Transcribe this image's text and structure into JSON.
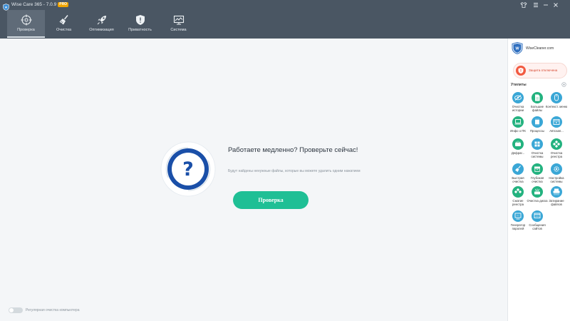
{
  "app": {
    "title": "Wise Care 365 - 7.0.9",
    "badge": "PRO"
  },
  "nav": {
    "tabs": [
      {
        "id": "check",
        "label": "Проверка",
        "icon": "crosshair-icon",
        "active": true
      },
      {
        "id": "clean",
        "label": "Очистка",
        "icon": "broom-icon",
        "active": false
      },
      {
        "id": "optimize",
        "label": "Оптимизация",
        "icon": "rocket-icon",
        "active": false
      },
      {
        "id": "privacy",
        "label": "Приватность",
        "icon": "shield-icon",
        "active": false
      },
      {
        "id": "system",
        "label": "Система",
        "icon": "monitor-icon",
        "active": false
      }
    ]
  },
  "main": {
    "headline": "Работаете медленно? Проверьте сейчас!",
    "subtext": "Будут найдены ненужные файлы, которые вы можете удалить одним нажатием",
    "scan_button": "Проверка",
    "toggle_label": "Регулярная очистка компьютера"
  },
  "sidebar": {
    "account_label": "WiseCleaner.com",
    "protection_label": "Защита отключена",
    "utilities_title": "Утилиты",
    "utilities": [
      {
        "label": "Очистка истории",
        "icon": "eye-slash-icon",
        "color": "#3aa7d6"
      },
      {
        "label": "Большие файлы",
        "icon": "file-icon",
        "color": "#23b27f"
      },
      {
        "label": "Контекст. меню",
        "icon": "mouse-icon",
        "color": "#3aa7d6"
      },
      {
        "label": "Инфо о ПК",
        "icon": "laptop-icon",
        "color": "#23b27f"
      },
      {
        "label": "Процессы",
        "icon": "chip-icon",
        "color": "#3aa7d6"
      },
      {
        "label": "Автозап...",
        "icon": "window-icon",
        "color": "#3aa7d6"
      },
      {
        "label": "Дефраг...",
        "icon": "disk-icon",
        "color": "#23b27f"
      },
      {
        "label": "Очистка системы",
        "icon": "windows-icon",
        "color": "#3aa7d6"
      },
      {
        "label": "Очистка реестра",
        "icon": "cubes-icon",
        "color": "#23b27f"
      },
      {
        "label": "Быстрая очистка",
        "icon": "broom-icon",
        "color": "#3aa7d6"
      },
      {
        "label": "Глубокая очистка",
        "icon": "archive-icon",
        "color": "#23b27f"
      },
      {
        "label": "Настройка системы",
        "icon": "gear-icon",
        "color": "#3aa7d6"
      },
      {
        "label": "Сжатие реестра",
        "icon": "compress-icon",
        "color": "#23b27f"
      },
      {
        "label": "Очистка диска",
        "icon": "hdd-icon",
        "color": "#23b27f"
      },
      {
        "label": "Затирание файлов",
        "icon": "shredder-icon",
        "color": "#3aa7d6"
      },
      {
        "label": "Генератор паролей",
        "icon": "key-icon",
        "color": "#3aa7d6"
      },
      {
        "label": "Сообщения сайтов",
        "icon": "message-icon",
        "color": "#3aa7d6"
      }
    ]
  },
  "colors": {
    "topbar": "#4a5663",
    "accent_green": "#1fbf95",
    "question_blue": "#1a4fa8",
    "warning_red": "#f25a41"
  }
}
